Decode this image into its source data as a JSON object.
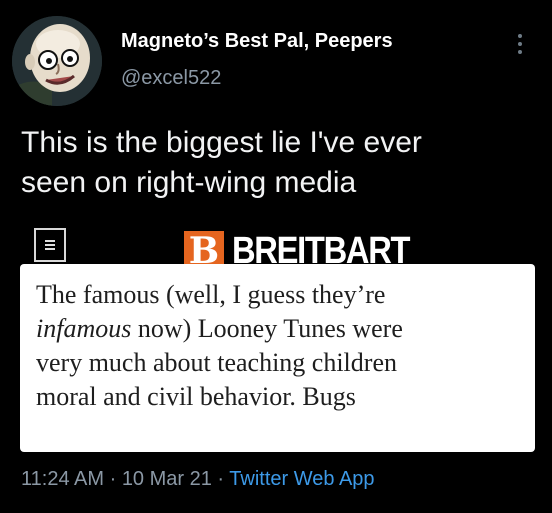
{
  "author": {
    "display_name": "Magneto’s Best Pal, Peepers",
    "handle": "@excel522",
    "avatar_icon": "bald-cartoon-face-avatar"
  },
  "tweet": {
    "text_lines": [
      "This is the biggest lie I've ever",
      "seen on right-wing media"
    ]
  },
  "embedded_screenshot": {
    "menu_icon": "hamburger-menu-icon",
    "logo": {
      "letter": "B",
      "wordmark": "BREITBART",
      "accent_color": "#e5651f"
    },
    "article_lines": [
      {
        "segments": [
          {
            "text": "The famous (well, I guess they’re",
            "italic": false
          }
        ]
      },
      {
        "segments": [
          {
            "text": "infamous",
            "italic": true
          },
          {
            "text": " now) Looney Tunes were",
            "italic": false
          }
        ]
      },
      {
        "segments": [
          {
            "text": "very much about teaching children",
            "italic": false
          }
        ]
      },
      {
        "segments": [
          {
            "text": "moral and civil behavior. Bugs",
            "italic": false
          }
        ]
      }
    ]
  },
  "meta": {
    "time": "11:24 AM",
    "separator": " · ",
    "date": "10 Mar 21",
    "source": "Twitter Web App",
    "source_color": "#3d9ae8"
  },
  "more_icon": "vertical-ellipsis-icon"
}
